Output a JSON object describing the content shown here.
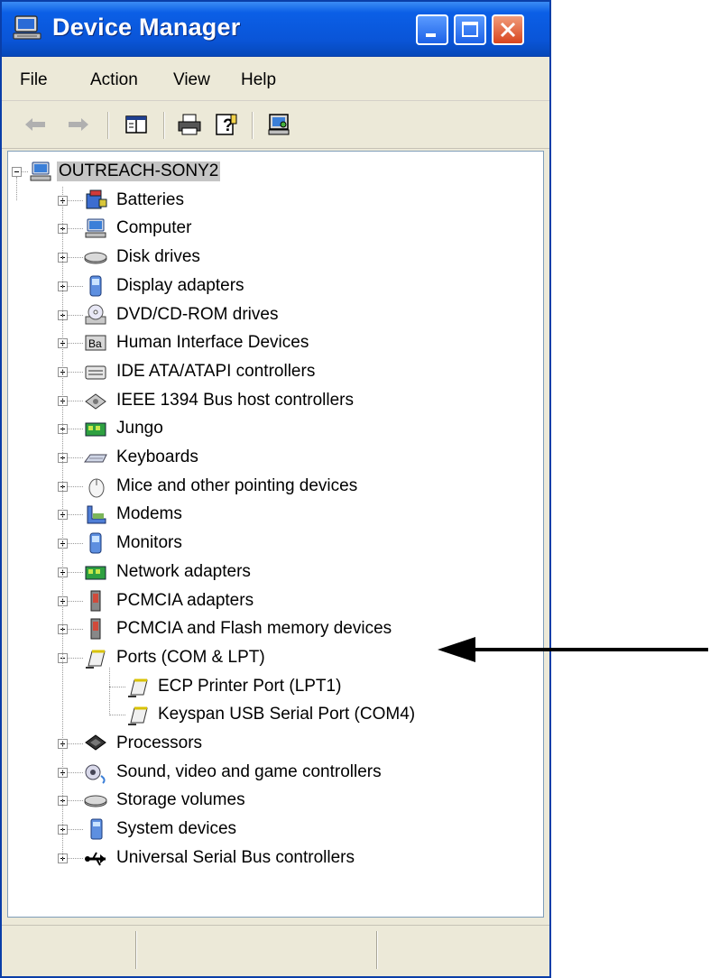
{
  "window": {
    "title": "Device Manager"
  },
  "menu": [
    "File",
    "Action",
    "View",
    "Help"
  ],
  "toolbar": {
    "buttons": [
      "back-icon",
      "forward-icon",
      "properties-view-icon",
      "print-icon",
      "help-icon",
      "scan-hardware-icon"
    ]
  },
  "tree": {
    "root": {
      "label": "OUTREACH-SONY2",
      "icon": "computer-icon"
    },
    "categories": [
      {
        "label": "Batteries",
        "icon": "battery-icon",
        "expanded": false
      },
      {
        "label": "Computer",
        "icon": "computer-icon",
        "expanded": false
      },
      {
        "label": "Disk drives",
        "icon": "disk-drive-icon",
        "expanded": false
      },
      {
        "label": "Display adapters",
        "icon": "display-adapter-icon",
        "expanded": false
      },
      {
        "label": "DVD/CD-ROM drives",
        "icon": "dvd-drive-icon",
        "expanded": false
      },
      {
        "label": "Human Interface Devices",
        "icon": "hid-icon",
        "expanded": false
      },
      {
        "label": "IDE ATA/ATAPI controllers",
        "icon": "ide-controller-icon",
        "expanded": false
      },
      {
        "label": "IEEE 1394 Bus host controllers",
        "icon": "ieee1394-icon",
        "expanded": false
      },
      {
        "label": "Jungo",
        "icon": "jungo-icon",
        "expanded": false
      },
      {
        "label": "Keyboards",
        "icon": "keyboard-icon",
        "expanded": false
      },
      {
        "label": "Mice and other pointing devices",
        "icon": "mouse-icon",
        "expanded": false
      },
      {
        "label": "Modems",
        "icon": "modem-icon",
        "expanded": false
      },
      {
        "label": "Monitors",
        "icon": "monitor-icon",
        "expanded": false
      },
      {
        "label": "Network adapters",
        "icon": "network-adapter-icon",
        "expanded": false
      },
      {
        "label": "PCMCIA adapters",
        "icon": "pcmcia-icon",
        "expanded": false
      },
      {
        "label": "PCMCIA and Flash memory devices",
        "icon": "pcmcia-flash-icon",
        "expanded": false
      },
      {
        "label": "Ports (COM & LPT)",
        "icon": "port-icon",
        "expanded": true,
        "children": [
          {
            "label": "ECP Printer Port (LPT1)",
            "icon": "port-icon"
          },
          {
            "label": "Keyspan USB Serial Port (COM4)",
            "icon": "port-icon"
          }
        ]
      },
      {
        "label": "Processors",
        "icon": "processor-icon",
        "expanded": false
      },
      {
        "label": "Sound, video and game controllers",
        "icon": "sound-icon",
        "expanded": false
      },
      {
        "label": "Storage volumes",
        "icon": "storage-volume-icon",
        "expanded": false
      },
      {
        "label": "System devices",
        "icon": "system-device-icon",
        "expanded": false
      },
      {
        "label": "Universal Serial Bus controllers",
        "icon": "usb-icon",
        "expanded": false
      }
    ]
  },
  "colors": {
    "titlebar": "#0a55d8",
    "window_bg": "#ece9d8",
    "selection": "#c5c5c5",
    "arrow": "#000000"
  }
}
